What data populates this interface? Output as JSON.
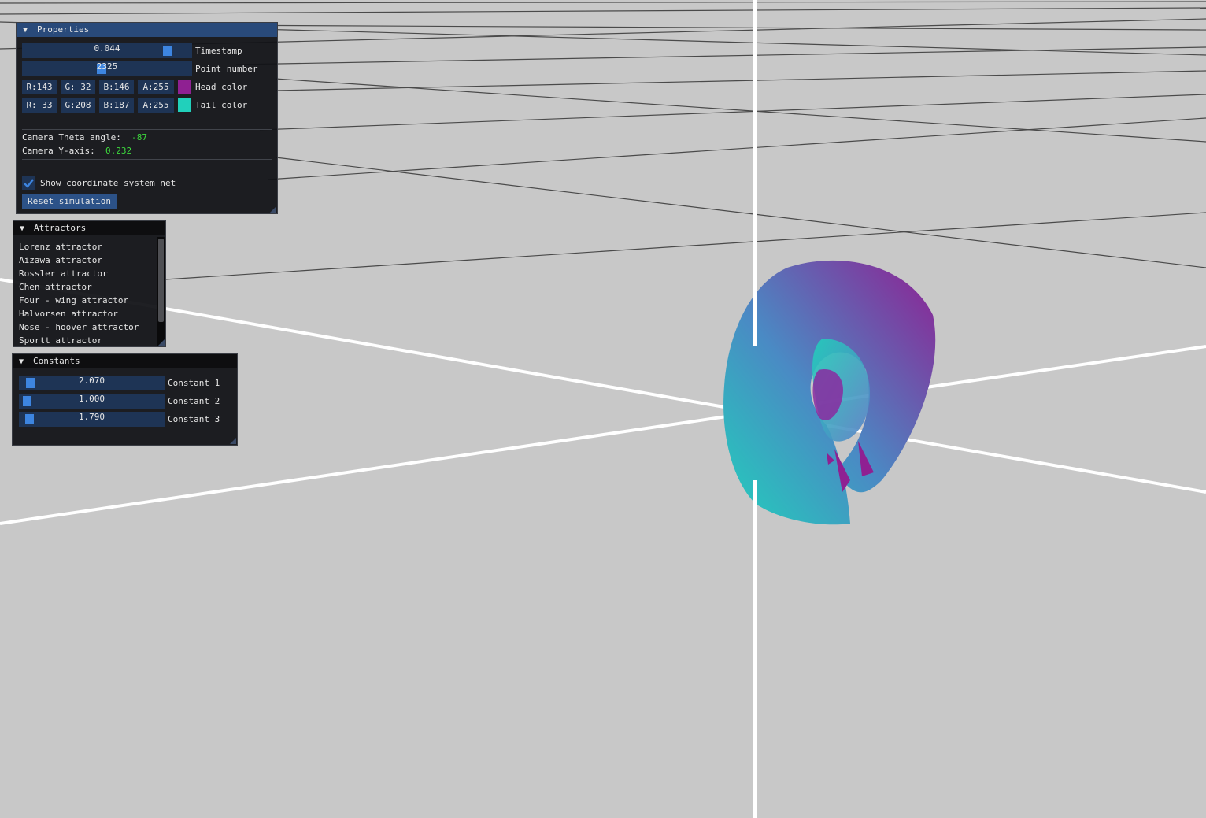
{
  "properties": {
    "title": "Properties",
    "timestamp": {
      "value": "0.044",
      "label": "Timestamp",
      "fraction": 0.88
    },
    "point_number": {
      "value": "2325",
      "label": "Point number"
    },
    "head_color": {
      "r": "R:143",
      "g": "G: 32",
      "b": "B:146",
      "a": "A:255",
      "label": "Head color",
      "swatch": "#8f2092"
    },
    "tail_color": {
      "r": "R: 33",
      "g": "G:208",
      "b": "B:187",
      "a": "A:255",
      "label": "Tail color",
      "swatch": "#21d0bb"
    },
    "camera_theta": {
      "label": "Camera Theta angle:",
      "value": "-87"
    },
    "camera_y": {
      "label": "Camera Y-axis:",
      "value": "0.232"
    },
    "show_net": {
      "label": "Show coordinate system net",
      "checked": true
    },
    "reset_label": "Reset simulation"
  },
  "attractors": {
    "title": "Attractors",
    "items": [
      "Lorenz attractor",
      "Aizawa attractor",
      "Rossler attractor",
      "Chen attractor",
      "Four - wing attractor",
      "Halvorsen attractor",
      "Nose - hoover attractor",
      "Sportt attractor"
    ]
  },
  "constants": {
    "title": "Constants",
    "items": [
      {
        "value": "2.070",
        "label": "Constant 1"
      },
      {
        "value": "1.000",
        "label": "Constant 2"
      },
      {
        "value": "1.790",
        "label": "Constant 3"
      }
    ]
  },
  "colors": {
    "background": "#c8c8c8",
    "accent": "#3d85e0",
    "head": "#8f2092",
    "tail": "#21d0bb",
    "frame": "#1e3455",
    "stat_number": "#3ddb3d"
  }
}
